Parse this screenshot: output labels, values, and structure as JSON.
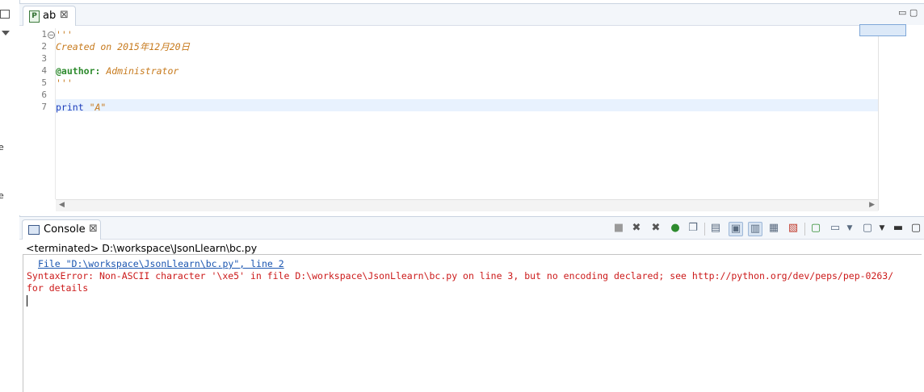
{
  "editor": {
    "tab": {
      "label": "ab",
      "icon": "python-file-icon",
      "close": "⊠"
    },
    "lines": [
      {
        "num": "1",
        "text": "'''"
      },
      {
        "num": "2",
        "text": "Created on 2015年12月20日"
      },
      {
        "num": "3",
        "text": ""
      },
      {
        "num": "4",
        "decorator": "@author:",
        "text": " Administrator"
      },
      {
        "num": "5",
        "text": "'''"
      },
      {
        "num": "6",
        "text": ""
      },
      {
        "num": "7",
        "keyword": "print",
        "string": "\"A\""
      }
    ],
    "colors": {
      "comment": "#c77a1d",
      "keyword": "#1c3dbb",
      "decorator": "#2e8b2e",
      "current_line": "#e8f2fe"
    }
  },
  "console": {
    "tab": {
      "label": "Console",
      "icon": "console-icon",
      "close": "⊠"
    },
    "terminated_label": "<terminated> D:\\workspace\\JsonLlearn\\bc.py",
    "output": {
      "link_line": "File \"D:\\workspace\\JsonLlearn\\bc.py\", line 2",
      "error_line": "SyntaxError: Non-ASCII character '\\xe5' in file D:\\workspace\\JsonLlearn\\bc.py on line 3, but no encoding declared; see http://python.org/dev/peps/pep-0263/",
      "error_cont": "for details"
    },
    "toolbar": [
      "terminate-icon",
      "remove-launch-icon",
      "remove-all-terminated-icon",
      "run-icon",
      "copy-icon",
      "clear-console-icon",
      "scroll-lock-icon",
      "word-wrap-icon",
      "pin-console-icon",
      "display-selected-console-icon",
      "open-console-icon",
      "view-menu-icon",
      "minimize-icon",
      "maximize-icon"
    ],
    "colors": {
      "error": "#cc1a1a",
      "link": "#1a55b0"
    }
  },
  "left_strip": {
    "fragments": [
      "e",
      "e"
    ]
  }
}
